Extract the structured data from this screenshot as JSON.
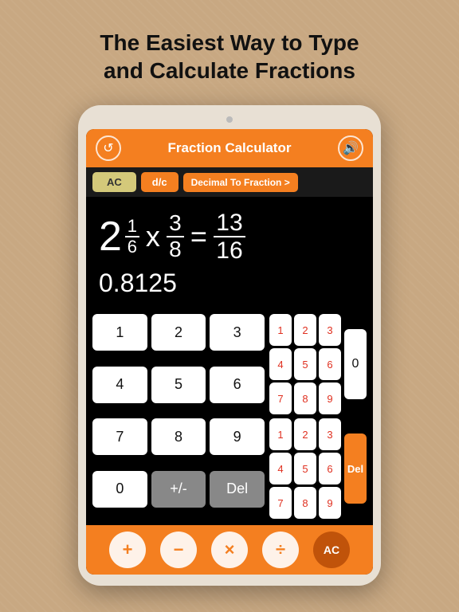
{
  "headline": {
    "line1": "The Easiest Way to Type",
    "line2": "and Calculate Fractions"
  },
  "header": {
    "title": "Fraction Calculator",
    "left_icon": "↺",
    "right_icon": "🔊"
  },
  "toolbar": {
    "ac_label": "AC",
    "dc_label": "d/c",
    "decimal_label": "Decimal To Fraction >"
  },
  "display": {
    "whole": "2",
    "frac_num": "1",
    "frac_den": "6",
    "operator": "x",
    "second_num": "3",
    "second_den": "8",
    "result_num": "13",
    "result_den": "16",
    "decimal": "0.8125"
  },
  "main_keys": [
    "1",
    "2",
    "3",
    "4",
    "5",
    "6",
    "7",
    "8",
    "9",
    "0",
    "+/-",
    "Del"
  ],
  "frac_keys_top": [
    "1",
    "2",
    "3",
    "4",
    "5",
    "6",
    "7",
    "8",
    "9"
  ],
  "frac_keys_bot": [
    "1",
    "2",
    "3",
    "4",
    "5",
    "6",
    "7",
    "8",
    "9"
  ],
  "operators": [
    "+",
    "−",
    "×",
    "÷",
    "AC"
  ]
}
